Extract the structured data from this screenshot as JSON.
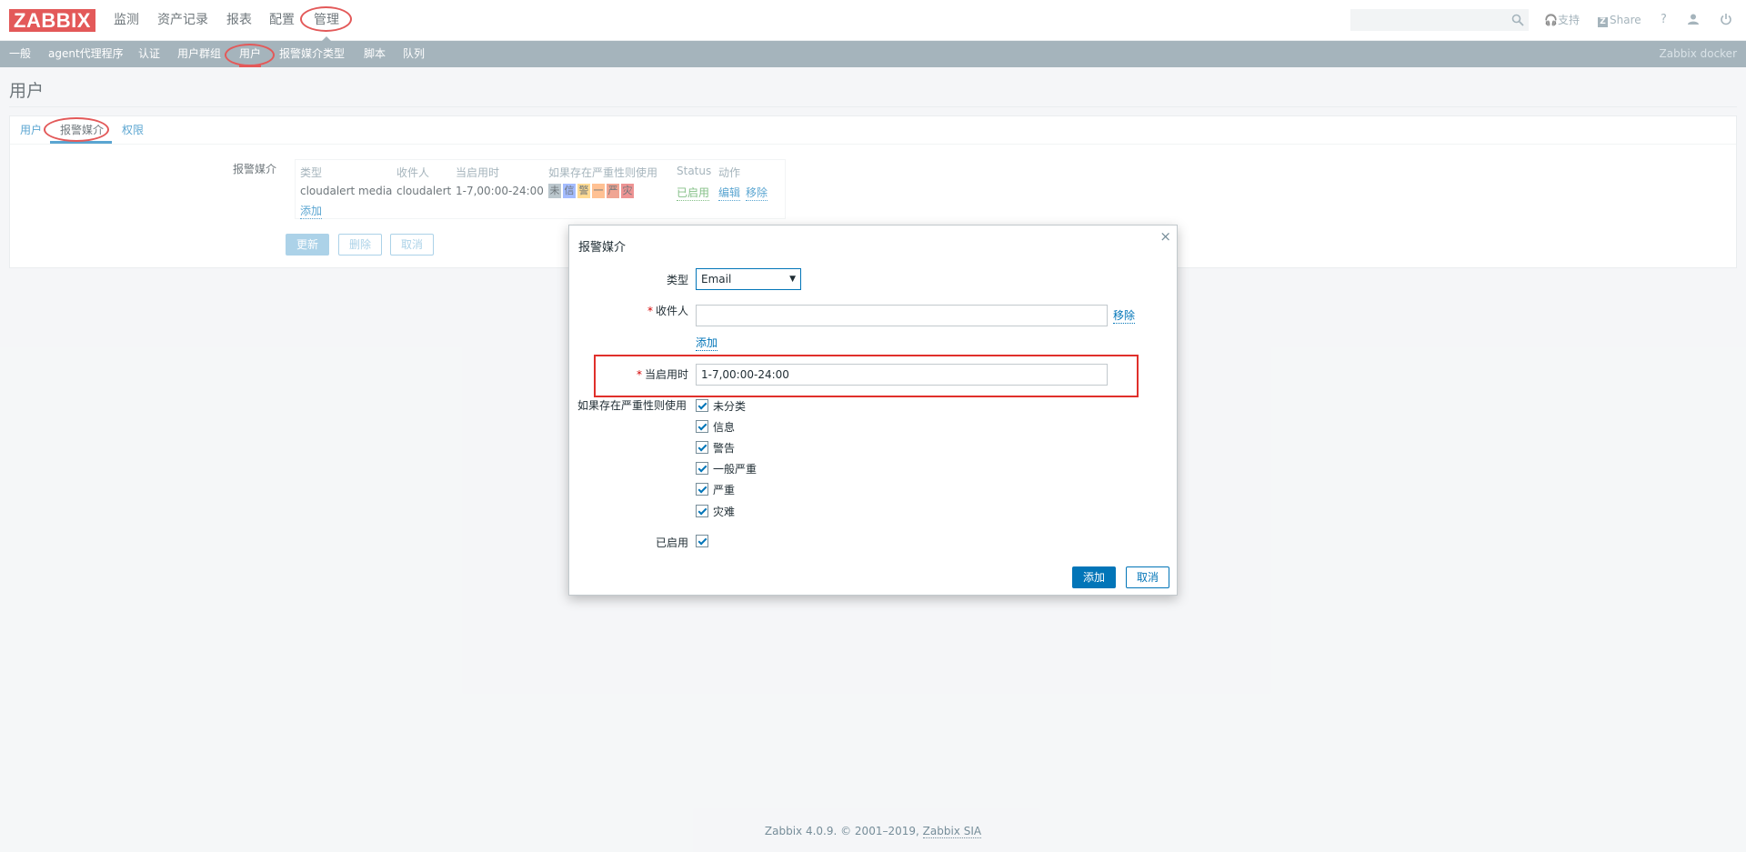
{
  "header": {
    "logo": "ZABBIX",
    "main_menu": [
      "监测",
      "资产记录",
      "报表",
      "配置",
      "管理"
    ],
    "search": {
      "value": "",
      "placeholder": ""
    },
    "support": "支持",
    "share": "Share",
    "help": "?"
  },
  "sub_nav": {
    "items": [
      "一般",
      "agent代理程序",
      "认证",
      "用户群组",
      "用户",
      "报警媒介类型",
      "脚本",
      "队列"
    ],
    "server_name": "Zabbix docker"
  },
  "page": {
    "title": "用户",
    "tabs": [
      "用户",
      "报警媒介",
      "权限"
    ]
  },
  "media_form": {
    "label": "报警媒介",
    "columns": [
      "类型",
      "收件人",
      "当启用时",
      "如果存在严重性则使用",
      "Status",
      "动作"
    ],
    "rows": [
      {
        "type": "cloudalert media",
        "recipient": "cloudalert",
        "when_active": "1-7,00:00-24:00",
        "severities": [
          "未",
          "信",
          "警",
          "一",
          "严",
          "灾"
        ],
        "status": "已启用",
        "action_edit": "编辑",
        "action_remove": "移除"
      }
    ],
    "add_link": "添加",
    "buttons": {
      "update": "更新",
      "delete": "删除",
      "cancel": "取消"
    }
  },
  "modal": {
    "title": "报警媒介",
    "close": "×",
    "type_label": "类型",
    "type_value": "Email",
    "recipient_label": "收件人",
    "recipient_value": "",
    "recipient_remove": "移除",
    "add_link": "添加",
    "when_active_label": "当启用时",
    "when_active_value": "1-7,00:00-24:00",
    "severity_label": "如果存在严重性则使用",
    "severities": [
      "未分类",
      "信息",
      "警告",
      "一般严重",
      "严重",
      "灾难"
    ],
    "enabled_label": "已启用",
    "add_button": "添加",
    "cancel_button": "取消"
  },
  "footer": {
    "text": "Zabbix 4.0.9. © 2001–2019,",
    "link": "Zabbix SIA"
  },
  "colors": {
    "brand": "#d40000",
    "link": "#0275b8",
    "nav": "#768d99",
    "enabled": "#429e47",
    "severity": [
      "#97aab3",
      "#7499ff",
      "#ffc859",
      "#ffa059",
      "#e97659",
      "#e45959"
    ]
  }
}
